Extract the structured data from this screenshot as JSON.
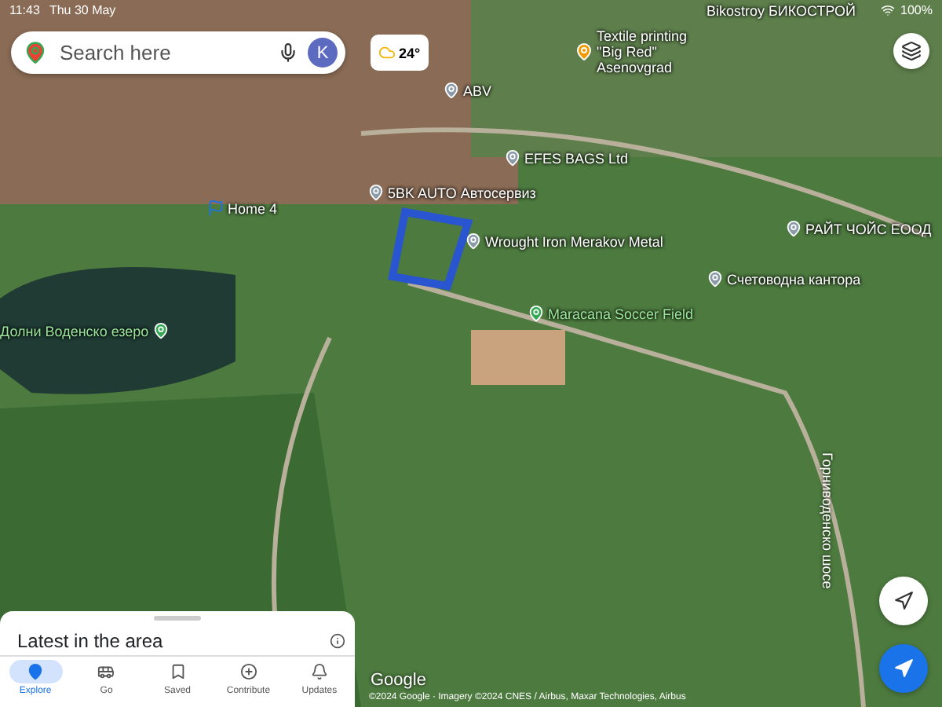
{
  "status_bar": {
    "time": "11:43",
    "date": "Thu 30 May",
    "battery": "100%"
  },
  "search": {
    "placeholder": "Search here",
    "avatar": "K"
  },
  "weather": {
    "temperature": "24°"
  },
  "map_labels": [
    {
      "text": "Textile printing \"Big Red\" Asenovgrad",
      "kind": "place"
    },
    {
      "text": "Bikostroy БИКОСТРОЙ",
      "kind": "plain"
    },
    {
      "text": "ABV",
      "kind": "pin"
    },
    {
      "text": "EFES BAGS Ltd",
      "kind": "pin"
    },
    {
      "text": "Home 4",
      "kind": "flag"
    },
    {
      "text": "5BK AUTO Автосервиз",
      "kind": "pin"
    },
    {
      "text": "Wrought Iron Merakov Metal",
      "kind": "pin"
    },
    {
      "text": "РАЙТ ЧОЙС ЕООД",
      "kind": "pin"
    },
    {
      "text": "Счетоводна кантора",
      "kind": "pin"
    },
    {
      "text": "Maracana Soccer Field",
      "kind": "green"
    },
    {
      "text": "Долни Воденско езеро",
      "kind": "lake"
    }
  ],
  "road_label": "Горниводенско шосе",
  "sheet": {
    "title": "Latest in the area"
  },
  "nav": [
    {
      "label": "Explore",
      "selected": true
    },
    {
      "label": "Go",
      "selected": false
    },
    {
      "label": "Saved",
      "selected": false
    },
    {
      "label": "Contribute",
      "selected": false
    },
    {
      "label": "Updates",
      "selected": false
    }
  ],
  "logo": "Google",
  "attribution": "©2024 Google · Imagery ©2024 CNES / Airbus, Maxar Technologies, Airbus"
}
